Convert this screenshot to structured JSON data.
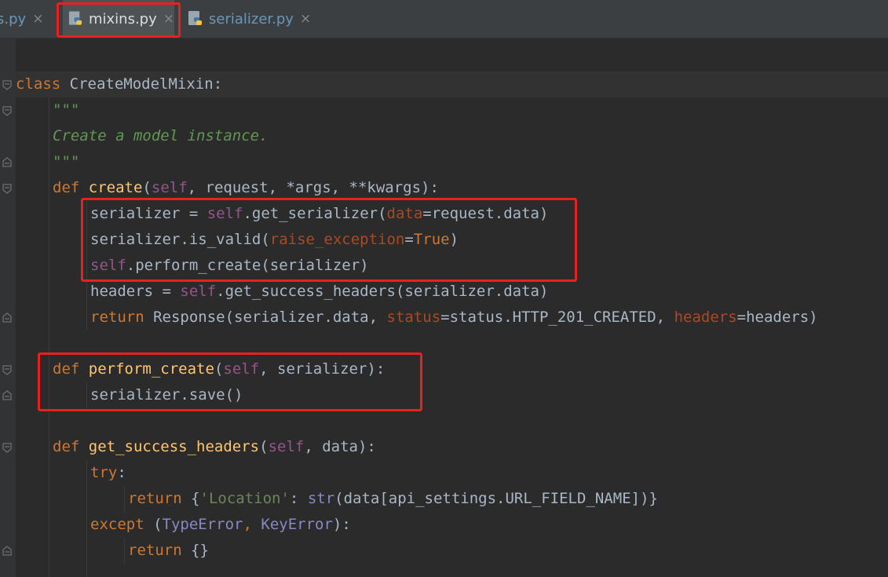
{
  "tabs": [
    {
      "label": "s.py",
      "active": false
    },
    {
      "label": "mixins.py",
      "active": true
    },
    {
      "label": "serializer.py",
      "active": false
    }
  ],
  "close_glyph": "×",
  "code": {
    "l1": {
      "kw": "class",
      "name": "CreateModelMixin",
      "colon": ":"
    },
    "l2": {
      "text": "\"\"\""
    },
    "l3": {
      "text": "Create a model instance."
    },
    "l4": {
      "text": "\"\"\""
    },
    "l5": {
      "kw": "def",
      "fn": "create",
      "open": "(",
      "self": "self",
      "rest": ", request, *args, **kwargs):"
    },
    "l6": {
      "a": "serializer = ",
      "self": "self",
      "b": ".get_serializer(",
      "p": "data",
      "c": "=request.data)"
    },
    "l7": {
      "a": "serializer.is_valid(",
      "p": "raise_exception",
      "eq": "=",
      "kw": "True",
      "c": ")"
    },
    "l8": {
      "self": "self",
      "a": ".perform_create(serializer)"
    },
    "l9": {
      "a": "headers = ",
      "self": "self",
      "b": ".get_success_headers(serializer.data)"
    },
    "l10": {
      "kw": "return",
      "a": " Response(serializer.data, ",
      "p1": "status",
      "b": "=status.HTTP_201_CREATED, ",
      "p2": "headers",
      "c": "=headers)"
    },
    "l12": {
      "kw": "def",
      "fn": "perform_create",
      "open": "(",
      "self": "self",
      "rest": ", serializer):"
    },
    "l13": {
      "a": "serializer.save()"
    },
    "l15": {
      "kw": "def",
      "fn": "get_success_headers",
      "open": "(",
      "self": "self",
      "rest": ", data):"
    },
    "l16": {
      "kw": "try",
      "colon": ":"
    },
    "l17": {
      "kw": "return",
      "a": " {",
      "s": "'Location'",
      "b": ": ",
      "bi": "str",
      "c": "(data[api_settings.URL_FIELD_NAME])}"
    },
    "l18": {
      "kw": "except",
      "a": " (",
      "t1": "TypeError",
      "sep": ", ",
      "t2": "KeyError",
      "c": "):"
    },
    "l19": {
      "kw": "return",
      "a": " {}"
    }
  },
  "colors": {
    "highlight": "#e8201e",
    "background": "#2b2b2b",
    "keyword": "#cc7832",
    "function": "#ffc66d",
    "self": "#94558d",
    "docstring": "#629755"
  },
  "icons": [
    "python-file-icon",
    "close-icon",
    "fold-icon"
  ]
}
